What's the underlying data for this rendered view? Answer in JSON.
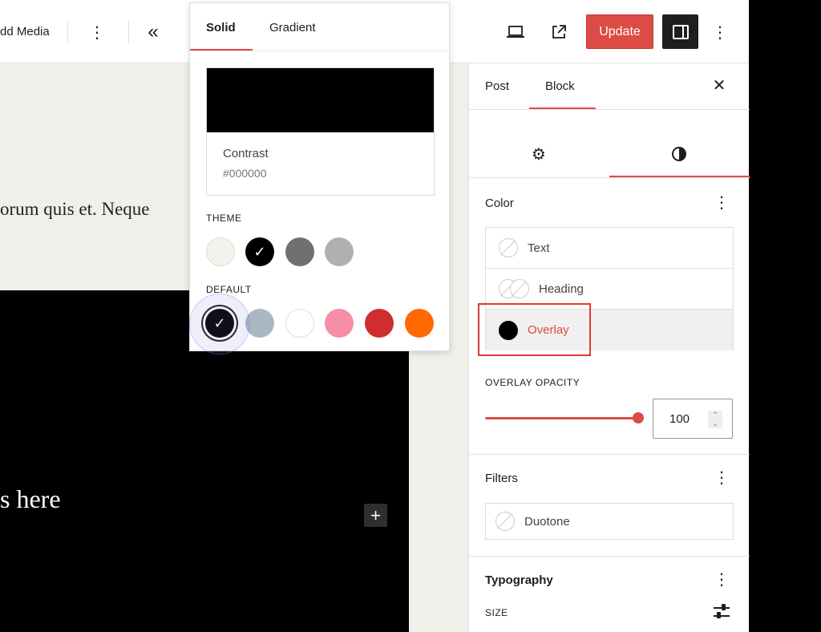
{
  "toolbar": {
    "add_media_label": "dd Media",
    "update_label": "Update",
    "icons": [
      "more-vertical-icon",
      "chevrons-left-icon",
      "desktop-preview-icon",
      "external-link-icon",
      "sidebar-icon",
      "more-vertical-icon"
    ]
  },
  "canvas": {
    "paragraph_text": "orum quis et. Neque",
    "cover_text": "s here"
  },
  "color_popover": {
    "tabs": [
      "Solid",
      "Gradient"
    ],
    "active_tab": "Solid",
    "selected_color_name": "Contrast",
    "selected_color_hex": "#000000",
    "theme_label": "THEME",
    "theme_colors": [
      "#f2f2ec",
      "#000000",
      "#707070",
      "#b0b0b0"
    ],
    "default_label": "DEFAULT",
    "default_colors": [
      "#000000",
      "#abb8c3",
      "#ffffff",
      "#f78da7",
      "#cf2e2e",
      "#ff6900"
    ]
  },
  "sidebar": {
    "tabs": [
      "Post",
      "Block"
    ],
    "active_tab": "Block",
    "color_panel": {
      "title": "Color",
      "items": [
        {
          "label": "Text"
        },
        {
          "label": "Heading"
        },
        {
          "label": "Overlay",
          "color": "#000000"
        }
      ]
    },
    "overlay_opacity": {
      "label": "OVERLAY OPACITY",
      "value": "100"
    },
    "filters_panel": {
      "title": "Filters",
      "duotone_label": "Duotone"
    },
    "typography_panel": {
      "title": "Typography",
      "size_label": "SIZE"
    }
  },
  "accent_color": "#dd4b45"
}
